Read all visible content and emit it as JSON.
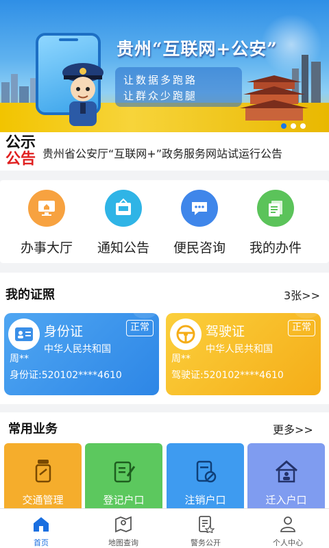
{
  "banner": {
    "title": "贵州“互联网+公安”",
    "slogan_line1": "让数据多跑路",
    "slogan_line2": "让群众少跑腿",
    "dots": 3,
    "active_dot": 0
  },
  "notice": {
    "badge_line1": "公示",
    "badge_line2": "公告",
    "text": "贵州省公安厅“互联网+”政务服务网站试运行公告"
  },
  "quick_actions": [
    {
      "label": "办事大厅",
      "icon": "monitor-icon",
      "color": "#f7a240"
    },
    {
      "label": "通知公告",
      "icon": "bulletin-icon",
      "color": "#2fb4e6"
    },
    {
      "label": "便民咨询",
      "icon": "chat-icon",
      "color": "#3f86ea"
    },
    {
      "label": "我的办件",
      "icon": "documents-icon",
      "color": "#5bc35a"
    }
  ],
  "certificates": {
    "title": "我的证照",
    "more": "3张>>",
    "cards": [
      {
        "name": "身份证",
        "status": "正常",
        "issuer": "中华人民共和国",
        "holder": "周**",
        "number": "身份证:520102****4610"
      },
      {
        "name": "驾驶证",
        "status": "正常",
        "issuer": "中华人民共和国",
        "holder": "周**",
        "number": "驾驶证:520102****4610"
      }
    ]
  },
  "services": {
    "title": "常用业务",
    "more": "更多>>",
    "items": [
      {
        "label": "交通管理",
        "color": "#f5ad2c"
      },
      {
        "label": "登记户口",
        "color": "#5cc85e"
      },
      {
        "label": "注销户口",
        "color": "#3e9bf0"
      },
      {
        "label": "迁入户口",
        "color": "#7f9cf0"
      }
    ]
  },
  "tabbar": {
    "active": 0,
    "items": [
      {
        "label": "首页",
        "icon": "home-icon"
      },
      {
        "label": "地图查询",
        "icon": "map-icon"
      },
      {
        "label": "警务公开",
        "icon": "police-notice-icon"
      },
      {
        "label": "个人中心",
        "icon": "user-icon"
      }
    ]
  },
  "colors": {
    "accent": "#1a6fe0",
    "notice_red": "#e02020"
  }
}
